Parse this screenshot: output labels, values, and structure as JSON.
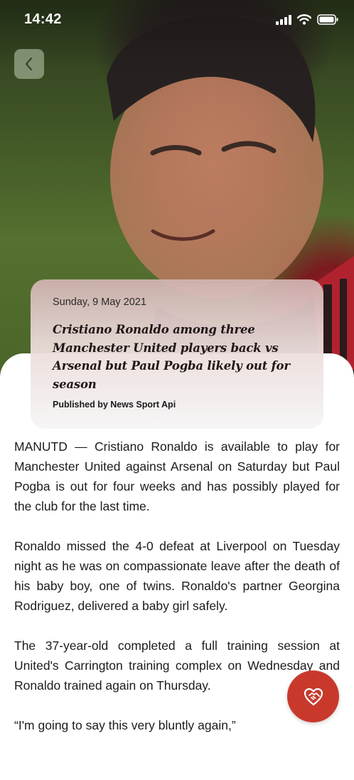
{
  "status_bar": {
    "time": "14:42",
    "icons": [
      "signal-icon",
      "wifi-icon",
      "battery-icon"
    ]
  },
  "navigation": {
    "back_icon": "chevron-left-icon"
  },
  "article": {
    "date": "Sunday, 9 May 2021",
    "title": "Cristiano Ronaldo among three Manchester United players back vs Arsenal but Paul Pogba likely out for season",
    "publisher": "Published by News Sport Api",
    "paragraphs": [
      "MANUTD — Cristiano Ronaldo is available to play for Manchester United against Arsenal on Saturday but Paul Pogba is out for four weeks and has possibly played for the club for the last time.",
      "Ronaldo missed the 4-0 defeat at Liverpool on Tuesday night as he was on compassionate leave after the death of his baby boy, one of twins. Ronaldo's partner Georgina Rodriguez, delivered a baby girl safely.",
      "The 37-year-old completed a full training session at United's Carrington training complex on Wednesday and Ronaldo trained again on Thursday.",
      "“I'm going to say this very bluntly again,”"
    ]
  },
  "favorite": {
    "icon": "heart-handshake-icon"
  },
  "colors": {
    "accent": "#c8392c",
    "text": "#1c1c1c",
    "card_top": "#d2b4b2",
    "card_bottom": "#f6f6f6"
  }
}
